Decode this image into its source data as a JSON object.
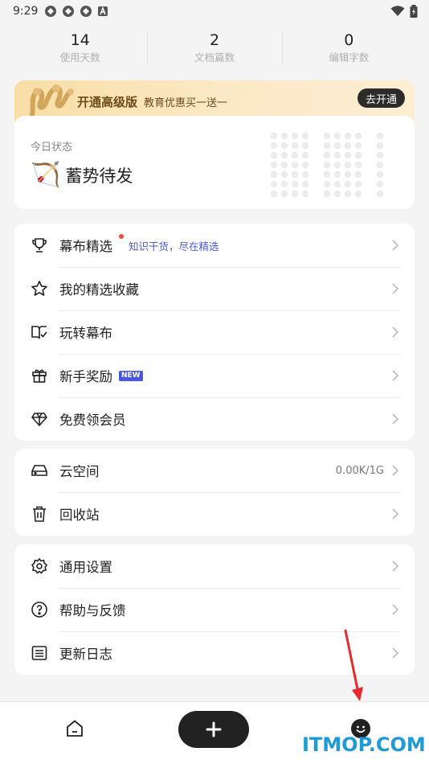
{
  "status_bar": {
    "time": "9:29",
    "icons": [
      "app-icon",
      "app-icon",
      "app-icon",
      "a-icon"
    ],
    "right_icons": [
      "wifi-icon",
      "battery-icon"
    ]
  },
  "stats": [
    {
      "value": "14",
      "label": "使用天数"
    },
    {
      "value": "2",
      "label": "文档篇数"
    },
    {
      "value": "0",
      "label": "编辑字数"
    }
  ],
  "promo": {
    "title": "开通高级版",
    "subtitle": "教育优惠买一送一",
    "button": "去开通"
  },
  "today": {
    "label": "今日状态",
    "emoji": "🏹",
    "status": "蓄势待发"
  },
  "menu_group1": [
    {
      "icon": "trophy-icon",
      "label": "幕布精选",
      "link": "知识干货，尽在精选",
      "dot": true
    },
    {
      "icon": "star-icon",
      "label": "我的精选收藏"
    },
    {
      "icon": "book-check-icon",
      "label": "玩转幕布"
    },
    {
      "icon": "gift-icon",
      "label": "新手奖励",
      "badge": "NEW"
    },
    {
      "icon": "diamond-icon",
      "label": "免费领会员"
    }
  ],
  "menu_group2": [
    {
      "icon": "drive-icon",
      "label": "云空间",
      "value": "0.00K/1G"
    },
    {
      "icon": "trash-icon",
      "label": "回收站"
    }
  ],
  "menu_group3": [
    {
      "icon": "gear-icon",
      "label": "通用设置"
    },
    {
      "icon": "help-icon",
      "label": "帮助与反馈"
    },
    {
      "icon": "list-icon",
      "label": "更新日志"
    }
  ],
  "bottom_nav": {
    "home_icon": "home-icon",
    "add_icon": "plus-icon",
    "me_icon": "smile-face-icon"
  },
  "watermark": "ITMOP.COM",
  "colors": {
    "accent": "#4b57e0",
    "promo_bg": "#f8dea6",
    "dark_button": "#222222",
    "red_dot": "#f04a3a"
  }
}
